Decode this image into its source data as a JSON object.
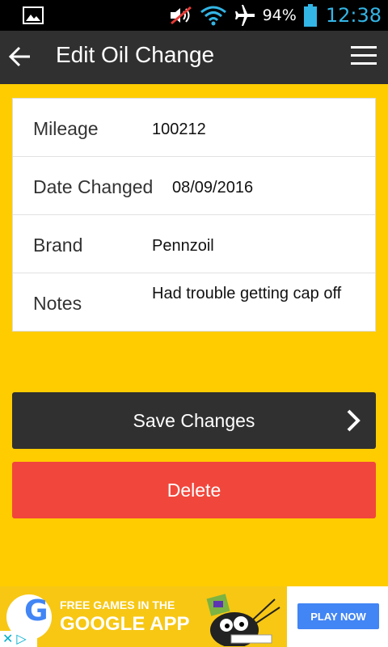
{
  "status_bar": {
    "battery_percent": "94%",
    "time": "12:38",
    "time_color": "#33b5e5"
  },
  "app_bar": {
    "title": "Edit Oil Change"
  },
  "form": {
    "fields": [
      {
        "label": "Mileage",
        "value": "100212"
      },
      {
        "label": "Date Changed",
        "value": "08/09/2016"
      },
      {
        "label": "Brand",
        "value": "Pennzoil"
      },
      {
        "label": "Notes",
        "value": "Had trouble getting cap off"
      }
    ]
  },
  "actions": {
    "save_label": "Save Changes",
    "delete_label": "Delete"
  },
  "ad": {
    "line1": "FREE GAMES IN THE",
    "line2": "GOOGLE APP",
    "cta": "PLAY NOW",
    "google_letter": "G"
  },
  "colors": {
    "background": "#ffcc00",
    "app_bar": "#303030",
    "delete": "#f1463c",
    "ad_cta": "#4285f4"
  }
}
